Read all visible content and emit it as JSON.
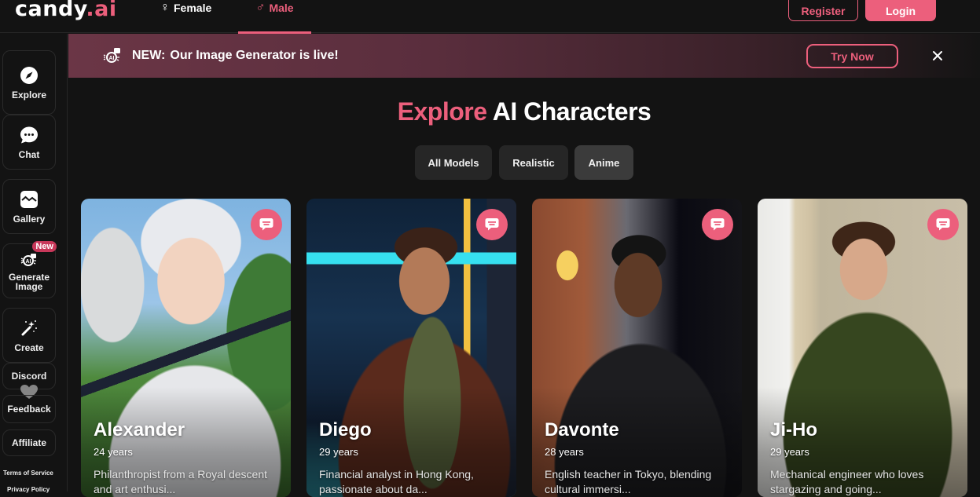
{
  "header": {
    "logo_main": "candy",
    "logo_accent": ".ai",
    "tabs": [
      {
        "label": "Female",
        "symbol": "♀",
        "active": false
      },
      {
        "label": "Male",
        "symbol": "♂",
        "active": true
      }
    ],
    "register_label": "Register",
    "login_label": "Login"
  },
  "sidebar": {
    "items": [
      {
        "label": "Explore",
        "icon": "compass-icon"
      },
      {
        "label": "Chat",
        "icon": "chat-bubble-icon"
      },
      {
        "label": "Gallery",
        "icon": "image-icon"
      },
      {
        "label": "Generate Image",
        "icon": "ai-image-icon",
        "badge": "New"
      },
      {
        "label": "Create",
        "icon": "magic-wand-icon"
      }
    ],
    "text_items": [
      {
        "label": "Discord"
      },
      {
        "label": "Feedback"
      },
      {
        "label": "Affiliate"
      }
    ],
    "links": [
      {
        "label": "Terms of Service"
      },
      {
        "label": "Privacy Policy"
      }
    ]
  },
  "banner": {
    "prefix": "NEW:",
    "text": "Our Image Generator is live!",
    "cta_label": "Try Now",
    "close_icon": "close-icon"
  },
  "main": {
    "title_accent": "Explore",
    "title_rest": " AI Characters",
    "filters": [
      {
        "label": "All Models",
        "active": false
      },
      {
        "label": "Realistic",
        "active": false
      },
      {
        "label": "Anime",
        "active": true
      }
    ],
    "characters": [
      {
        "name": "Alexander",
        "age": "24 years",
        "description": "Philanthropist from a Royal descent and art enthusi..."
      },
      {
        "name": "Diego",
        "age": "29 years",
        "description": "Financial analyst in Hong Kong, passionate about da..."
      },
      {
        "name": "Davonte",
        "age": "28 years",
        "description": "English teacher in Tokyo, blending cultural immersi..."
      },
      {
        "name": "Ji-Ho",
        "age": "29 years",
        "description": "Mechanical engineer who loves stargazing and going..."
      }
    ]
  },
  "colors": {
    "accent": "#ec5f7c",
    "background": "#131313",
    "chip": "#262626",
    "chip_active": "#3b3b3b"
  }
}
